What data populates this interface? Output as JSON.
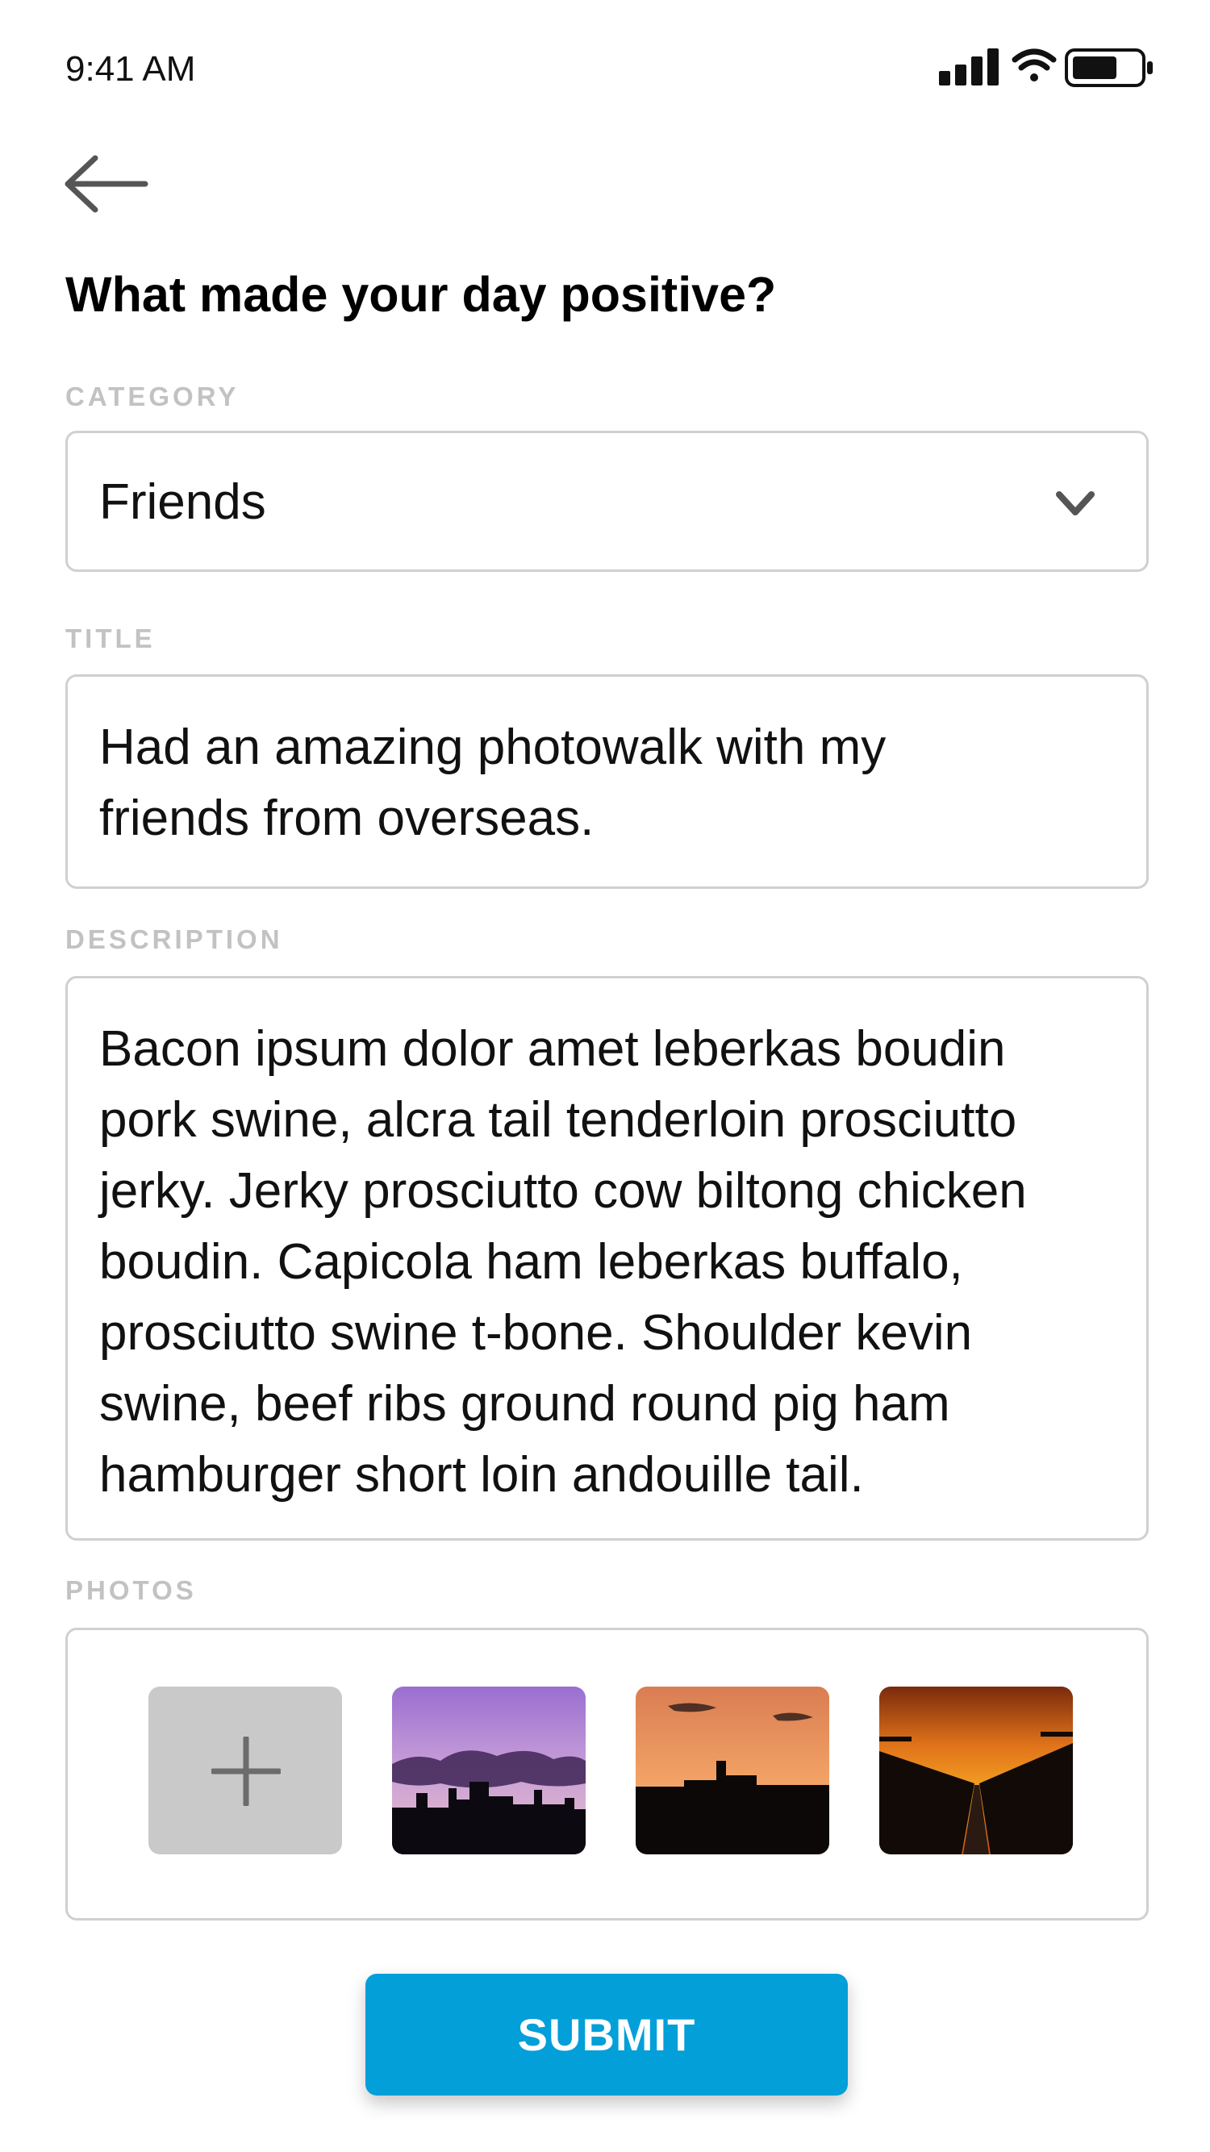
{
  "status_bar": {
    "time": "9:41 AM",
    "icons": [
      "signal-icon",
      "wifi-icon",
      "battery-icon"
    ]
  },
  "header": {
    "back_icon": "back-arrow-icon",
    "title": "What made your day positive?"
  },
  "form": {
    "category": {
      "label": "CATEGORY",
      "value": "Friends",
      "icon": "chevron-down-icon"
    },
    "title": {
      "label": "TITLE",
      "value": "Had an amazing photowalk with my\nfriends from overseas."
    },
    "description": {
      "label": "DESCRIPTION",
      "value": "Bacon ipsum dolor amet leberkas boudin\npork swine, alcra tail tenderloin prosciutto\njerky. Jerky prosciutto cow biltong chicken\nboudin. Capicola ham leberkas buffalo,\nprosciutto swine t-bone. Shoulder kevin\nswine, beef ribs ground round pig ham\nhamburger short loin andouille tail."
    },
    "photos": {
      "label": "PHOTOS",
      "add_icon": "plus-icon",
      "items": [
        "purple-sunset-photo",
        "orange-sunset-photo",
        "golden-sunset-photo"
      ]
    }
  },
  "actions": {
    "submit_label": "SUBMIT"
  },
  "colors": {
    "accent": "#039fd9",
    "label_gray": "#c2c2c2",
    "border_gray": "#d0d0d0",
    "add_tile": "#c9c9c9"
  }
}
